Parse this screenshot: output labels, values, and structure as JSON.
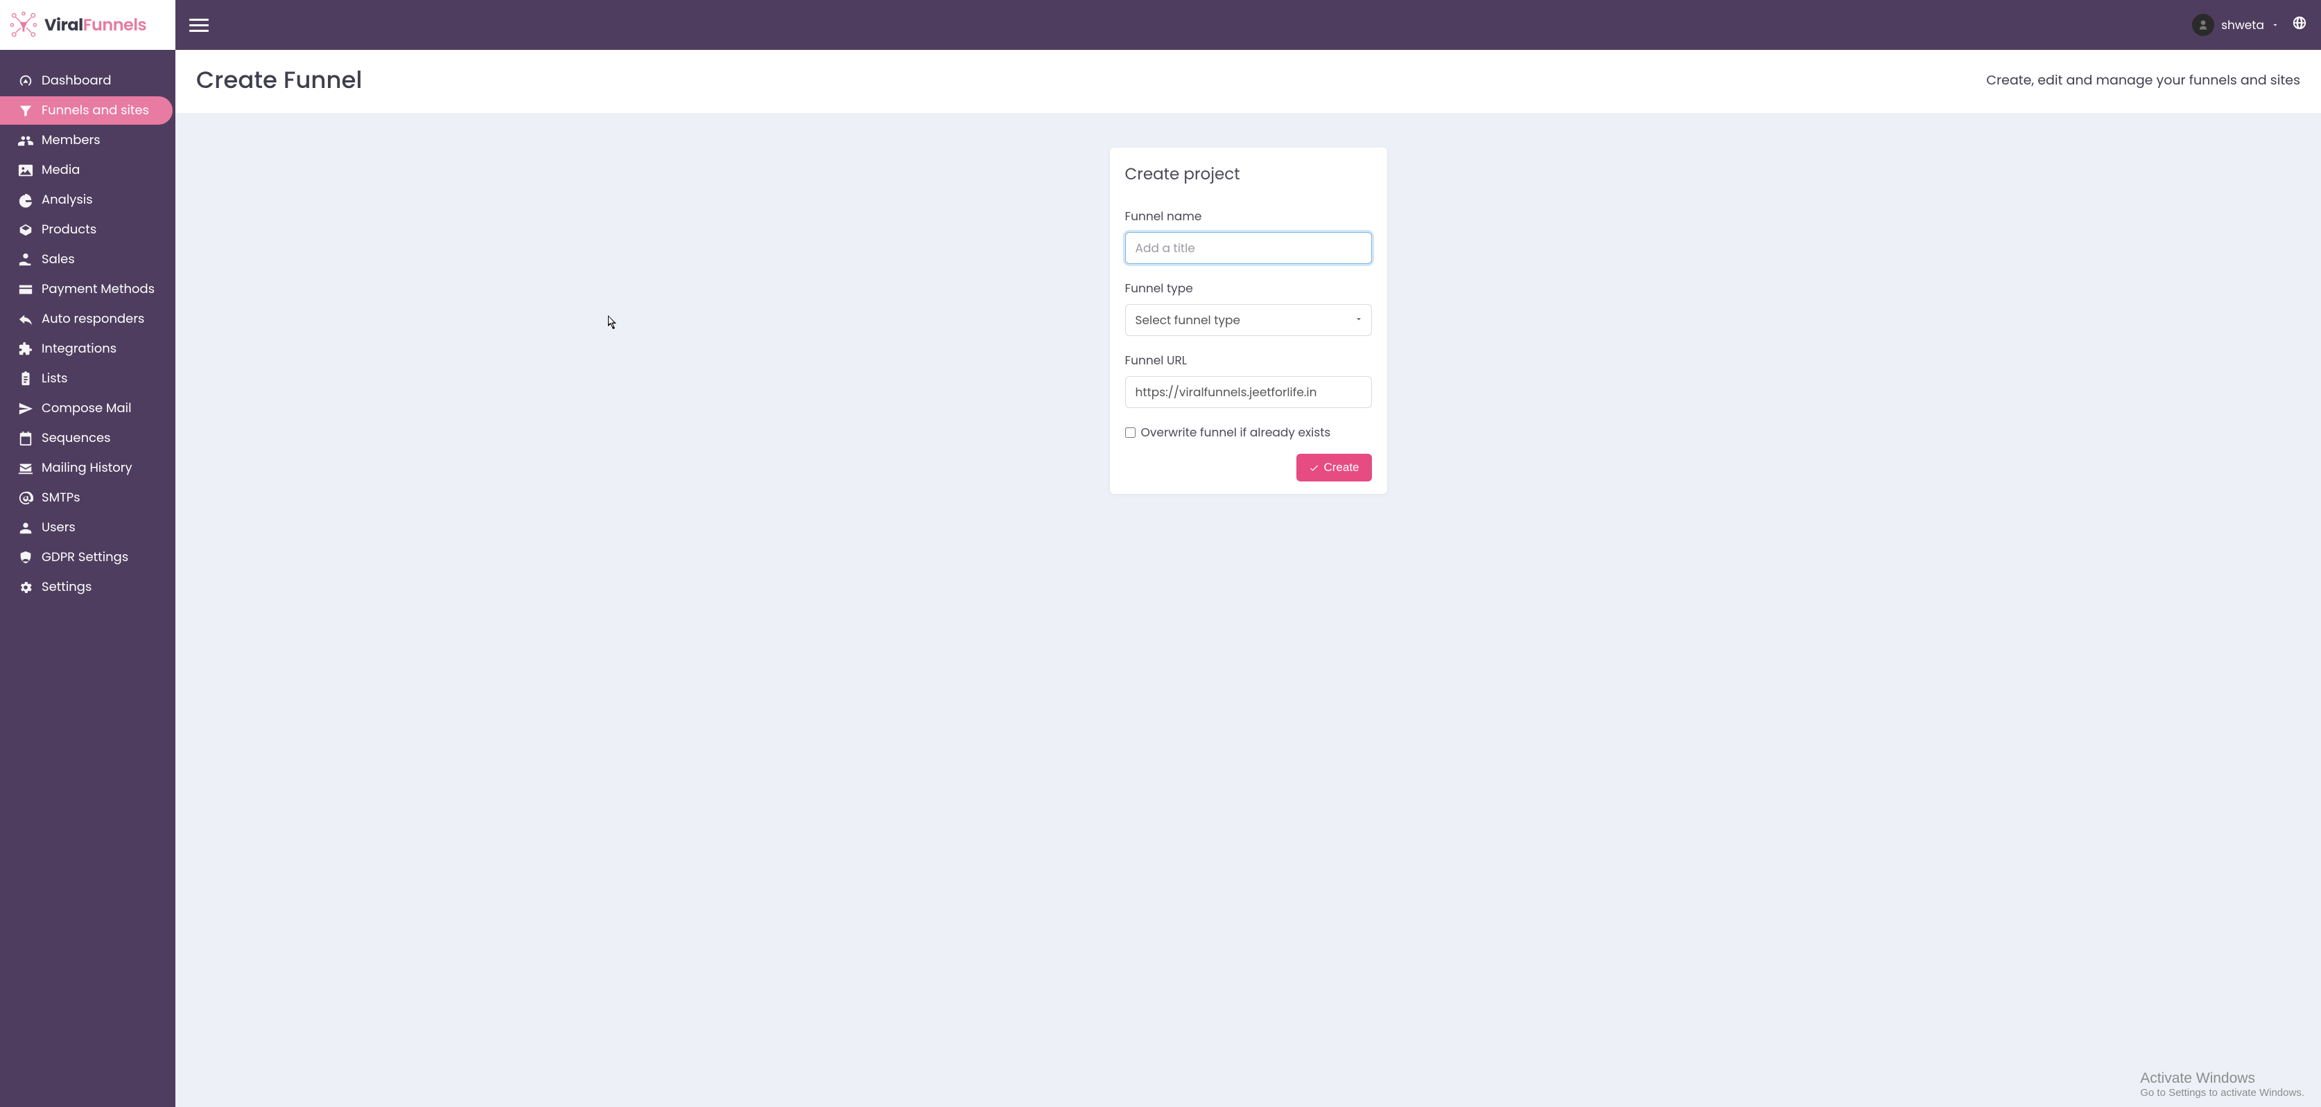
{
  "brand": {
    "name_part1": "Viral",
    "name_part2": "Funnels"
  },
  "sidebar": {
    "items": [
      {
        "label": "Dashboard"
      },
      {
        "label": "Funnels and sites"
      },
      {
        "label": "Members"
      },
      {
        "label": "Media"
      },
      {
        "label": "Analysis"
      },
      {
        "label": "Products"
      },
      {
        "label": "Sales"
      },
      {
        "label": "Payment Methods"
      },
      {
        "label": "Auto responders"
      },
      {
        "label": "Integrations"
      },
      {
        "label": "Lists"
      },
      {
        "label": "Compose Mail"
      },
      {
        "label": "Sequences"
      },
      {
        "label": "Mailing History"
      },
      {
        "label": "SMTPs"
      },
      {
        "label": "Users"
      },
      {
        "label": "GDPR Settings"
      },
      {
        "label": "Settings"
      }
    ],
    "active_index": 1
  },
  "topbar": {
    "user_name": "shweta"
  },
  "page": {
    "title": "Create Funnel",
    "subtitle": "Create, edit and manage your funnels and sites"
  },
  "card": {
    "title": "Create project",
    "funnel_name_label": "Funnel name",
    "funnel_name_placeholder": "Add a title",
    "funnel_name_value": "",
    "funnel_type_label": "Funnel type",
    "funnel_type_selected": "Select funnel type",
    "funnel_url_label": "Funnel URL",
    "funnel_url_value": "https://viralfunnels.jeetforlife.in",
    "overwrite_label": "Overwrite funnel if already exists",
    "overwrite_checked": false,
    "create_label": "Create"
  },
  "watermark": {
    "title": "Activate Windows",
    "sub": "Go to Settings to activate Windows."
  }
}
